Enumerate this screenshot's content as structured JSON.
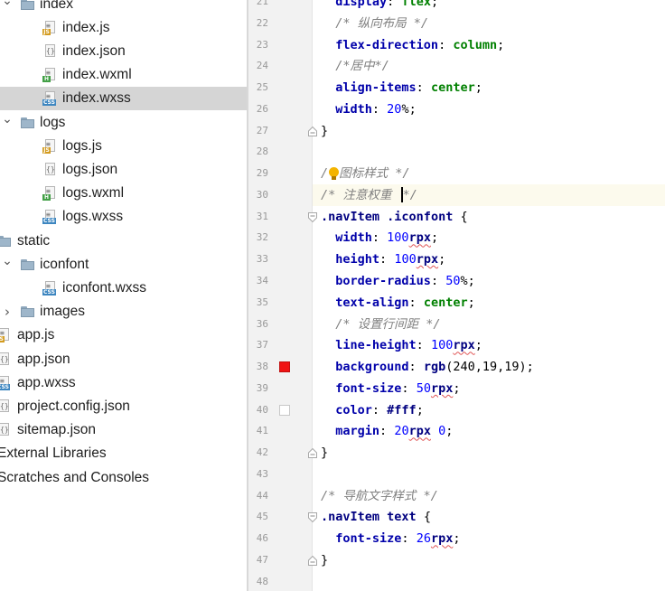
{
  "project_tree": {
    "items": [
      {
        "label": "index",
        "kind": "folder",
        "depth": 1,
        "expanded": true
      },
      {
        "label": "index.js",
        "kind": "js",
        "depth": 2
      },
      {
        "label": "index.json",
        "kind": "json",
        "depth": 2
      },
      {
        "label": "index.wxml",
        "kind": "wxml",
        "depth": 2
      },
      {
        "label": "index.wxss",
        "kind": "css",
        "depth": 2,
        "selected": true
      },
      {
        "label": "logs",
        "kind": "folder",
        "depth": 1,
        "expanded": true
      },
      {
        "label": "logs.js",
        "kind": "js",
        "depth": 2
      },
      {
        "label": "logs.json",
        "kind": "json",
        "depth": 2
      },
      {
        "label": "logs.wxml",
        "kind": "wxml",
        "depth": 2
      },
      {
        "label": "logs.wxss",
        "kind": "css",
        "depth": 2
      },
      {
        "label": "static",
        "kind": "folder",
        "depth": 0,
        "expanded": true
      },
      {
        "label": "iconfont",
        "kind": "folder",
        "depth": 1,
        "expanded": true
      },
      {
        "label": "iconfont.wxss",
        "kind": "css",
        "depth": 2
      },
      {
        "label": "images",
        "kind": "folder",
        "depth": 1,
        "expanded": false
      },
      {
        "label": "app.js",
        "kind": "js",
        "depth": 0
      },
      {
        "label": "app.json",
        "kind": "json",
        "depth": 0
      },
      {
        "label": "app.wxss",
        "kind": "css",
        "depth": 0
      },
      {
        "label": "project.config.json",
        "kind": "json",
        "depth": 0
      },
      {
        "label": "sitemap.json",
        "kind": "json",
        "depth": 0
      },
      {
        "label": "External Libraries",
        "kind": "none",
        "depth": -1
      },
      {
        "label": "Scratches and Consoles",
        "kind": "none",
        "depth": -1
      }
    ]
  },
  "editor": {
    "current_line": 30,
    "lines": [
      {
        "n": "21",
        "tokens": [
          {
            "t": "  "
          },
          {
            "t": "display",
            "c": "prop"
          },
          {
            "t": ": "
          },
          {
            "t": "flex",
            "c": "val"
          },
          {
            "t": ";"
          }
        ]
      },
      {
        "n": "22",
        "tokens": [
          {
            "t": "  "
          },
          {
            "t": "/* 纵向布局 */",
            "c": "com"
          }
        ]
      },
      {
        "n": "23",
        "tokens": [
          {
            "t": "  "
          },
          {
            "t": "flex-direction",
            "c": "prop"
          },
          {
            "t": ": "
          },
          {
            "t": "column",
            "c": "val"
          },
          {
            "t": ";"
          }
        ]
      },
      {
        "n": "24",
        "tokens": [
          {
            "t": "  "
          },
          {
            "t": "/*居中*/",
            "c": "com"
          }
        ]
      },
      {
        "n": "25",
        "tokens": [
          {
            "t": "  "
          },
          {
            "t": "align-items",
            "c": "prop"
          },
          {
            "t": ": "
          },
          {
            "t": "center",
            "c": "val"
          },
          {
            "t": ";"
          }
        ]
      },
      {
        "n": "26",
        "tokens": [
          {
            "t": "  "
          },
          {
            "t": "width",
            "c": "prop"
          },
          {
            "t": ": "
          },
          {
            "t": "20",
            "c": "num"
          },
          {
            "t": "%"
          },
          {
            "t": ";"
          }
        ]
      },
      {
        "n": "27",
        "fold": "end",
        "tokens": [
          {
            "t": "}"
          }
        ]
      },
      {
        "n": "28",
        "tokens": []
      },
      {
        "n": "29",
        "tokens": [
          {
            "t": "/",
            "c": "com"
          },
          {
            "bulb": true
          },
          {
            "t": "图标样式 */",
            "c": "com"
          }
        ]
      },
      {
        "n": "30",
        "tokens": [
          {
            "t": "/* 注意权重 ",
            "c": "com"
          },
          {
            "caret": true
          },
          {
            "t": "*/",
            "c": "com"
          }
        ]
      },
      {
        "n": "31",
        "fold": "start",
        "tokens": [
          {
            "t": ".navItem",
            "c": "sel"
          },
          {
            "t": " "
          },
          {
            "t": ".iconfont",
            "c": "sel"
          },
          {
            "t": " {"
          }
        ]
      },
      {
        "n": "32",
        "tokens": [
          {
            "t": "  "
          },
          {
            "t": "width",
            "c": "prop"
          },
          {
            "t": ": "
          },
          {
            "t": "100",
            "c": "num"
          },
          {
            "t": "rpx",
            "c": "unit"
          },
          {
            "t": ";"
          }
        ]
      },
      {
        "n": "33",
        "tokens": [
          {
            "t": "  "
          },
          {
            "t": "height",
            "c": "prop"
          },
          {
            "t": ": "
          },
          {
            "t": "100",
            "c": "num"
          },
          {
            "t": "rpx",
            "c": "unit"
          },
          {
            "t": ";"
          }
        ]
      },
      {
        "n": "34",
        "tokens": [
          {
            "t": "  "
          },
          {
            "t": "border-radius",
            "c": "prop"
          },
          {
            "t": ": "
          },
          {
            "t": "50",
            "c": "num"
          },
          {
            "t": "%"
          },
          {
            "t": ";"
          }
        ]
      },
      {
        "n": "35",
        "tokens": [
          {
            "t": "  "
          },
          {
            "t": "text-align",
            "c": "prop"
          },
          {
            "t": ": "
          },
          {
            "t": "center",
            "c": "val"
          },
          {
            "t": ";"
          }
        ]
      },
      {
        "n": "36",
        "tokens": [
          {
            "t": "  "
          },
          {
            "t": "/* 设置行间距 */",
            "c": "com"
          }
        ]
      },
      {
        "n": "37",
        "tokens": [
          {
            "t": "  "
          },
          {
            "t": "line-height",
            "c": "prop"
          },
          {
            "t": ": "
          },
          {
            "t": "100",
            "c": "num"
          },
          {
            "t": "rpx",
            "c": "unit"
          },
          {
            "t": ";"
          }
        ]
      },
      {
        "n": "38",
        "swatch": "#f01313",
        "tokens": [
          {
            "t": "  "
          },
          {
            "t": "background",
            "c": "prop"
          },
          {
            "t": ": "
          },
          {
            "t": "rgb",
            "c": "sel"
          },
          {
            "t": "(240,19,19)"
          },
          {
            "t": ";"
          }
        ]
      },
      {
        "n": "39",
        "tokens": [
          {
            "t": "  "
          },
          {
            "t": "font-size",
            "c": "prop"
          },
          {
            "t": ": "
          },
          {
            "t": "50",
            "c": "num"
          },
          {
            "t": "rpx",
            "c": "unit"
          },
          {
            "t": ";"
          }
        ]
      },
      {
        "n": "40",
        "swatch": "#ffffff",
        "tokens": [
          {
            "t": "  "
          },
          {
            "t": "color",
            "c": "prop"
          },
          {
            "t": ": "
          },
          {
            "t": "#fff",
            "c": "sel"
          },
          {
            "t": ";"
          }
        ]
      },
      {
        "n": "41",
        "tokens": [
          {
            "t": "  "
          },
          {
            "t": "margin",
            "c": "prop"
          },
          {
            "t": ": "
          },
          {
            "t": "20",
            "c": "num"
          },
          {
            "t": "rpx",
            "c": "unit"
          },
          {
            "t": " "
          },
          {
            "t": "0",
            "c": "num"
          },
          {
            "t": ";"
          }
        ]
      },
      {
        "n": "42",
        "fold": "end",
        "tokens": [
          {
            "t": "}"
          }
        ]
      },
      {
        "n": "43",
        "tokens": []
      },
      {
        "n": "44",
        "tokens": [
          {
            "t": "/* 导航文字样式 */",
            "c": "com"
          }
        ]
      },
      {
        "n": "45",
        "fold": "start",
        "tokens": [
          {
            "t": ".navItem",
            "c": "sel"
          },
          {
            "t": " "
          },
          {
            "t": "text",
            "c": "sel"
          },
          {
            "t": " {"
          }
        ]
      },
      {
        "n": "46",
        "tokens": [
          {
            "t": "  "
          },
          {
            "t": "font-size",
            "c": "prop"
          },
          {
            "t": ": "
          },
          {
            "t": "26",
            "c": "num"
          },
          {
            "t": "rpx",
            "c": "unit"
          },
          {
            "t": ";"
          }
        ]
      },
      {
        "n": "47",
        "fold": "end",
        "tokens": [
          {
            "t": "}"
          }
        ]
      },
      {
        "n": "48",
        "tokens": []
      }
    ]
  }
}
